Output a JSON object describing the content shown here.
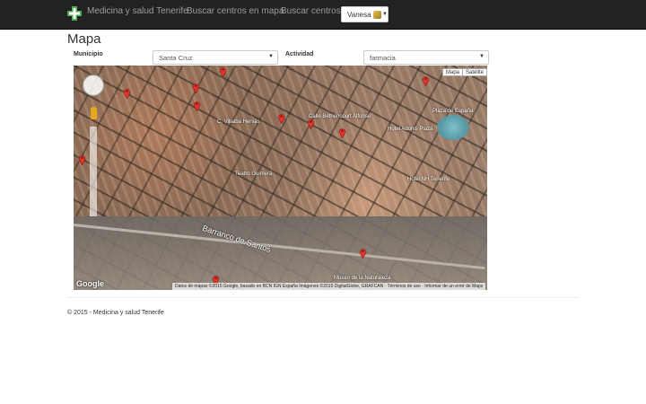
{
  "navbar": {
    "brand": "Medicina y salud Tenerife",
    "links": [
      "Buscar centros en mapa",
      "Buscar centros"
    ],
    "user": "Vanesa",
    "brand_color": "#4cae4c",
    "background": "#222222"
  },
  "page": {
    "title": "Mapa",
    "filters": {
      "municipio_label": "Municipio",
      "municipio_value": "Santa Cruz",
      "actividad_label": "Actividad",
      "actividad_value": "farmacia"
    }
  },
  "map": {
    "map_types": [
      "Mapa",
      "Satélite"
    ],
    "street_label": "Barranco de Santos",
    "place_labels": [
      "Calle Bethencourt Alfonso",
      "Hotel Adonis Plaza",
      "Hotel NH Tenerife",
      "Plaza de España",
      "Museo de la Naturaleza",
      "C. Villalba Hervás",
      "Teatro Guimerá"
    ],
    "attribution": "Datos de mapas ©2015 Google, basado en BCN IGN España Imágenes ©2015 DigitalGlobe, GRAFCAN · Términos de uso · Informar de un error de Maps",
    "google_logo": "Google",
    "pin_count": 11,
    "icons": [
      "pan-control-icon",
      "pegman-icon",
      "map-pin-icon"
    ]
  },
  "footer": {
    "text": "© 2015 - Medicina y salud Tenerife"
  }
}
